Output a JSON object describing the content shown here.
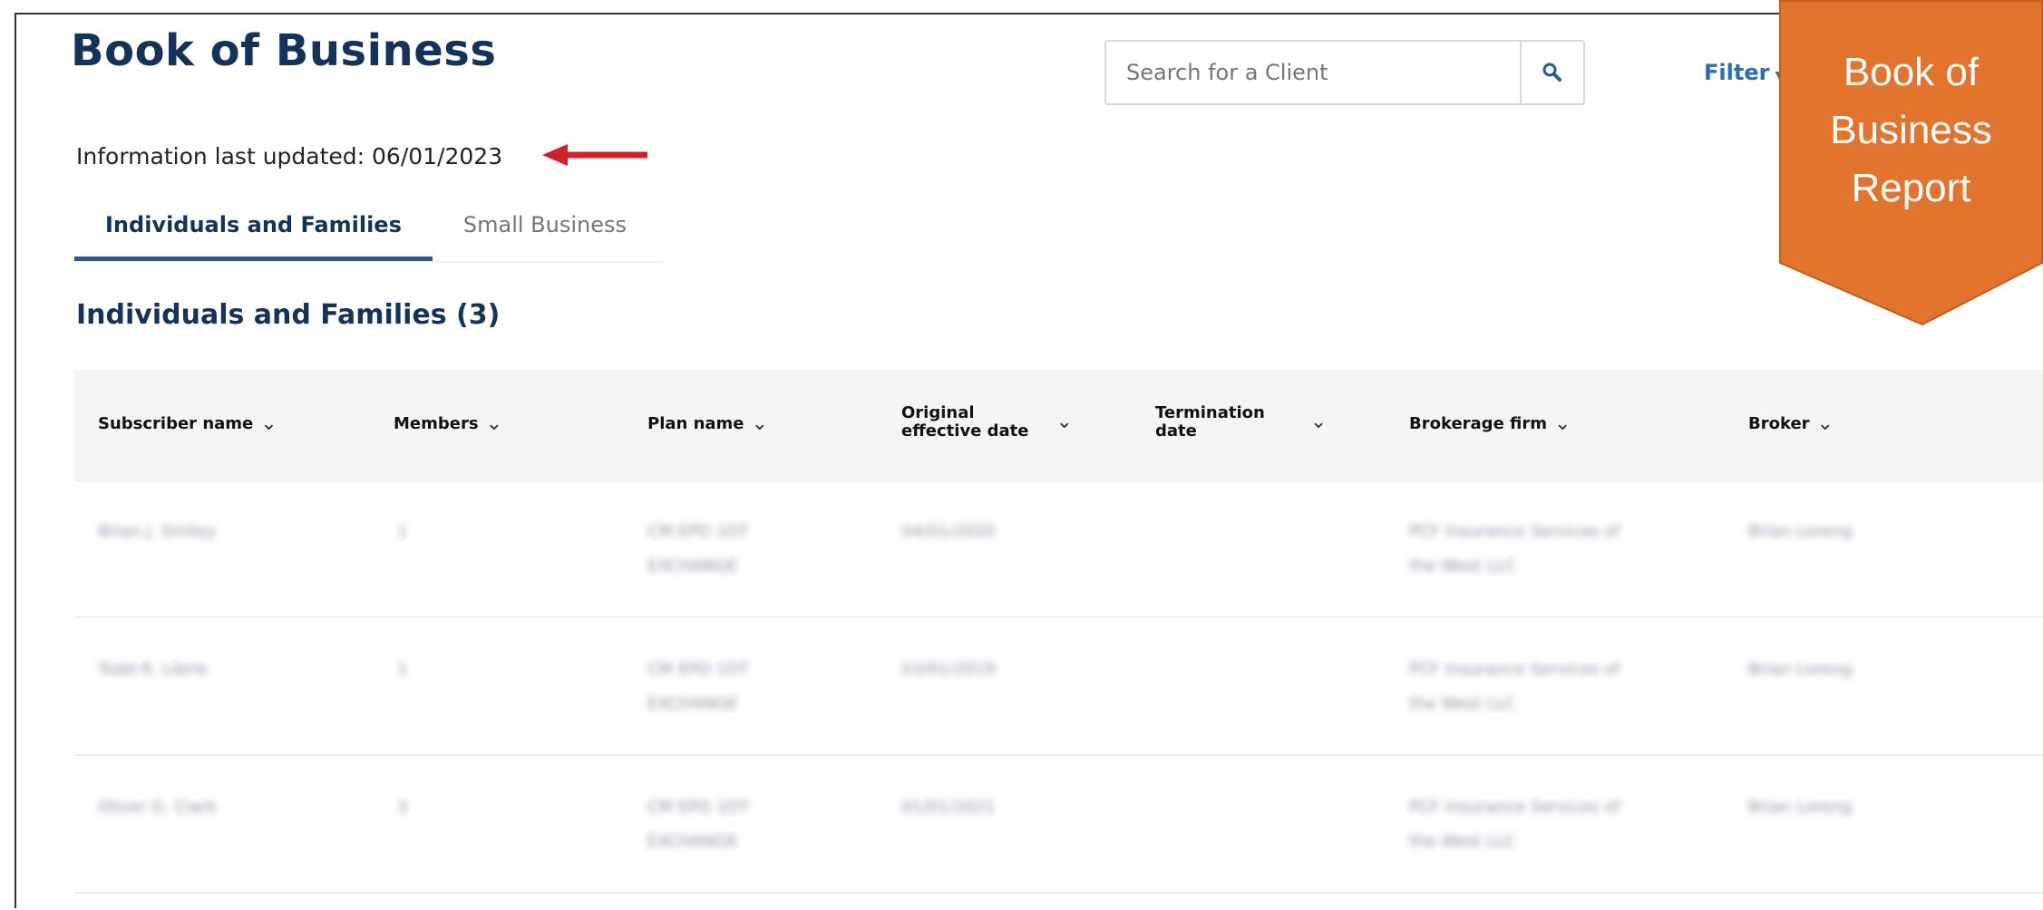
{
  "page": {
    "title": "Book of Business",
    "last_updated": "Information last updated: 06/01/2023"
  },
  "search": {
    "placeholder": "Search for a Client",
    "icon": "search-icon"
  },
  "filter": {
    "label": "Filter"
  },
  "tabs": [
    {
      "label": "Individuals and Families",
      "active": true
    },
    {
      "label": "Small Business",
      "active": false
    }
  ],
  "section": {
    "title": "Individuals and Families (3)"
  },
  "table": {
    "columns": [
      {
        "label": "Subscriber name"
      },
      {
        "label": "Members"
      },
      {
        "label": "Plan name"
      },
      {
        "label": "Original effective date",
        "line1": "Original",
        "line2": "effective date"
      },
      {
        "label": "Termination date",
        "line1": "Termination",
        "line2": "date"
      },
      {
        "label": "Brokerage firm"
      },
      {
        "label": "Broker"
      }
    ],
    "rows": [
      {
        "subscriber": "Brian J. Smiley",
        "members": "1",
        "plan_l1": "CM EPO 1DT",
        "plan_l2": "EXCHANGE",
        "effective": "04/01/2020",
        "termination": "",
        "firm_l1": "PCF Insurance Services of",
        "firm_l2": "the West LLC",
        "broker": "Brian Loreng"
      },
      {
        "subscriber": "Todd R. Librie",
        "members": "1",
        "plan_l1": "CM EPO 1DT",
        "plan_l2": "EXCHANGE",
        "effective": "03/01/2019",
        "termination": "",
        "firm_l1": "PCF Insurance Services of",
        "firm_l2": "the West LLC",
        "broker": "Brian Loreng"
      },
      {
        "subscriber": "Oliver G. Clark",
        "members": "3",
        "plan_l1": "CM EPO 1DT",
        "plan_l2": "EXCHANGE",
        "effective": "01/01/2021",
        "termination": "",
        "firm_l1": "PCF Insurance Services of",
        "firm_l2": "the West LLC",
        "broker": "Brian Loreng"
      }
    ]
  },
  "badge": {
    "line1": "Book of",
    "line2": "Business",
    "line3": "Report",
    "color": "#e2742e"
  },
  "colors": {
    "title": "#14335a",
    "link": "#2a6fb6",
    "tab_underline": "#1f5f93",
    "arrow": "#d0202a"
  }
}
